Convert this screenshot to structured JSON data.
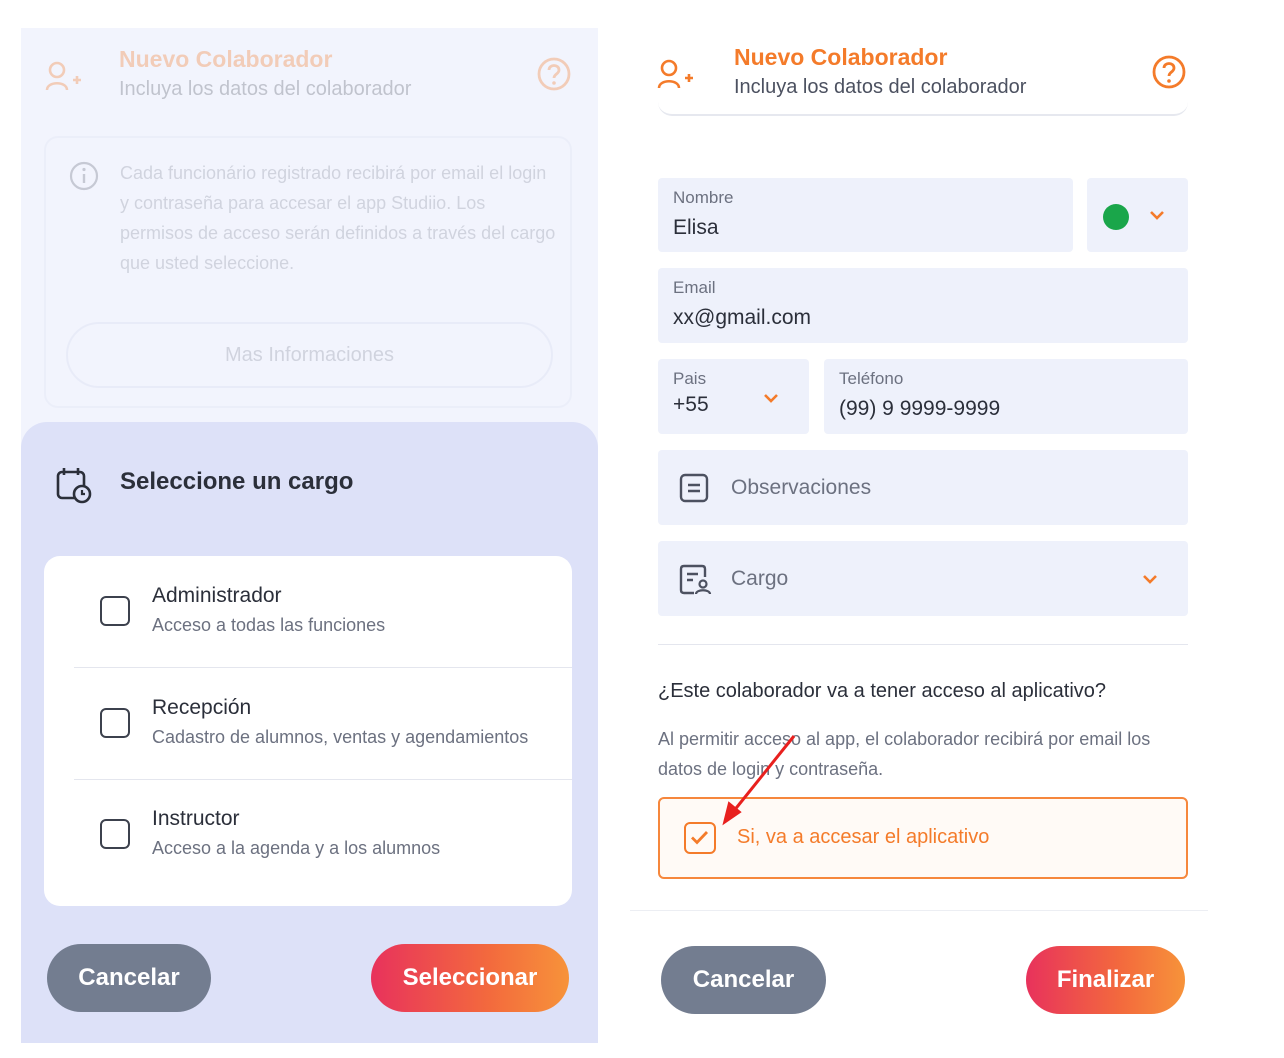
{
  "left": {
    "header": {
      "title": "Nuevo Colaborador",
      "subtitle": "Incluya los datos del colaborador",
      "icon": "add-user-icon",
      "help_icon": "help-icon"
    },
    "info": {
      "icon": "info-icon",
      "text": "Cada funcionário registrado recibirá por email el login y contraseña para accesar el app Studiio. Los permisos de acceso serán definidos a través del cargo que usted seleccione.",
      "more_button": "Mas Informaciones"
    },
    "sheet": {
      "icon": "calendar-clock-icon",
      "title": "Seleccione un cargo",
      "options": [
        {
          "title": "Administrador",
          "description": "Acceso a todas las funciones",
          "checked": false
        },
        {
          "title": "Recepción",
          "description": "Cadastro de alumnos, ventas y agendamientos",
          "checked": false
        },
        {
          "title": "Instructor",
          "description": "Acceso a la agenda y a los alumnos",
          "checked": false
        }
      ],
      "cancel": "Cancelar",
      "select": "Seleccionar"
    }
  },
  "right": {
    "header": {
      "title": "Nuevo Colaborador",
      "subtitle": "Incluya los datos del colaborador",
      "icon": "add-user-icon",
      "help_icon": "help-icon"
    },
    "form": {
      "name_label": "Nombre",
      "name_value": "Elisa",
      "status_color": "#1aa64a",
      "email_label": "Email",
      "email_value": "xx@gmail.com",
      "country_label": "Pais",
      "country_value": "+55",
      "phone_label": "Teléfono",
      "phone_value": "(99) 9 9999-9999",
      "notes_placeholder": "Observaciones",
      "role_placeholder": "Cargo"
    },
    "access": {
      "question": "¿Este colaborador va a tener acceso al aplicativo?",
      "description": "Al permitir acceso al app, el colaborador recibirá por email los datos de login y contraseña.",
      "checkbox_label": "Si, va a accesar el aplicativo",
      "checked": true
    },
    "cancel": "Cancelar",
    "finish": "Finalizar"
  },
  "colors": {
    "accent_orange": "#f47b2a",
    "gradient_start": "#e8325c",
    "gradient_end": "#f7933a",
    "cancel_gray": "#737d90",
    "annotation_red": "#e8201e"
  }
}
